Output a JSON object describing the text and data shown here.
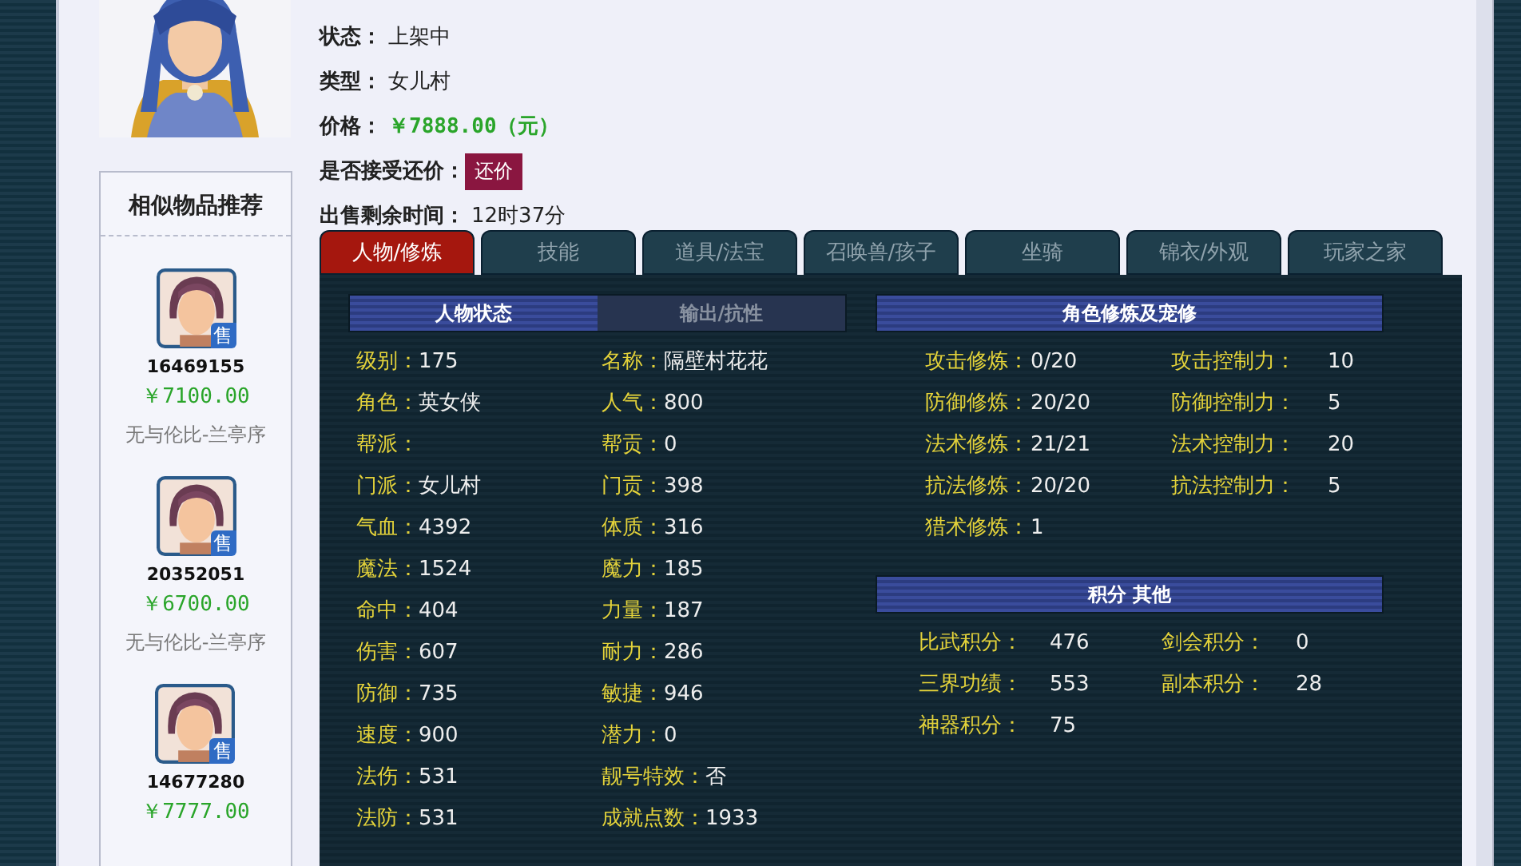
{
  "info": [
    {
      "label": "状态：",
      "value": "上架中",
      "kind": "text"
    },
    {
      "label": "类型：",
      "value": "女儿村",
      "kind": "text"
    },
    {
      "label": "价格：",
      "value": "￥7888.00（元）",
      "kind": "price"
    },
    {
      "label": "是否接受还价：",
      "value": "还价",
      "kind": "button"
    },
    {
      "label": "出售剩余时间：",
      "value": "12时37分",
      "kind": "text"
    }
  ],
  "similar": {
    "title": "相似物品推荐",
    "items": [
      {
        "id": "16469155",
        "price": "￥7100.00",
        "server": "无与伦比-兰亭序",
        "badge": "售"
      },
      {
        "id": "20352051",
        "price": "￥6700.00",
        "server": "无与伦比-兰亭序",
        "badge": "售"
      },
      {
        "id": "14677280",
        "price": "￥7777.00",
        "badge": "售"
      }
    ]
  },
  "tabs": [
    {
      "label": "人物/修炼",
      "selected": true
    },
    {
      "label": "技能",
      "selected": false
    },
    {
      "label": "道具/法宝",
      "selected": false
    },
    {
      "label": "召唤兽/孩子",
      "selected": false
    },
    {
      "label": "坐骑",
      "selected": false
    },
    {
      "label": "锦衣/外观",
      "selected": false
    },
    {
      "label": "玩家之家",
      "selected": false
    }
  ],
  "subtabs": [
    {
      "label": "人物状态",
      "selected": true
    },
    {
      "label": "输出/抗性",
      "selected": false
    }
  ],
  "stats_left": [
    {
      "label": "级别：",
      "value": "175"
    },
    {
      "label": "角色：",
      "value": "英女侠"
    },
    {
      "label": "帮派："
    },
    {
      "label": "门派：",
      "value": "女儿村"
    },
    {
      "label": "气血：",
      "value": "4392"
    },
    {
      "label": "魔法：",
      "value": "1524"
    },
    {
      "label": "命中：",
      "value": "404"
    },
    {
      "label": "伤害：",
      "value": "607"
    },
    {
      "label": "防御：",
      "value": "735"
    },
    {
      "label": "速度：",
      "value": "900"
    },
    {
      "label": "法伤：",
      "value": "531"
    },
    {
      "label": "法防：",
      "value": "531"
    }
  ],
  "stats_right": [
    {
      "label": "名称：",
      "value": "隔壁村花花"
    },
    {
      "label": "人气：",
      "value": "800"
    },
    {
      "label": "帮贡：",
      "value": "0"
    },
    {
      "label": "门贡：",
      "value": "398"
    },
    {
      "label": "体质：",
      "value": "316"
    },
    {
      "label": "魔力：",
      "value": "185"
    },
    {
      "label": "力量：",
      "value": "187"
    },
    {
      "label": "耐力：",
      "value": "286"
    },
    {
      "label": "敏捷：",
      "value": "946"
    },
    {
      "label": "潜力：",
      "value": "0"
    },
    {
      "label": "靓号特效：",
      "value": "否"
    },
    {
      "label": "成就点数：",
      "value": "1933"
    }
  ],
  "cultivation": {
    "title": "角色修炼及宠修",
    "rows": [
      {
        "label": "攻击修炼：",
        "value": "0/20",
        "label2": "攻击控制力：",
        "value2": "10"
      },
      {
        "label": "防御修炼：",
        "value": "20/20",
        "label2": "防御控制力：",
        "value2": "5"
      },
      {
        "label": "法术修炼：",
        "value": "21/21",
        "label2": "法术控制力：",
        "value2": "20"
      },
      {
        "label": "抗法修炼：",
        "value": "20/20",
        "label2": "抗法控制力：",
        "value2": "5"
      },
      {
        "label": "猎术修炼：",
        "value": "1"
      }
    ]
  },
  "points": {
    "title": "积分 其他",
    "rows": [
      {
        "label": "比武积分：",
        "value": "476",
        "label2": "剑会积分：",
        "value2": "0"
      },
      {
        "label": "三界功绩：",
        "value": "553",
        "label2": "副本积分：",
        "value2": "28"
      },
      {
        "label": "神器积分：",
        "value": "75"
      }
    ]
  }
}
